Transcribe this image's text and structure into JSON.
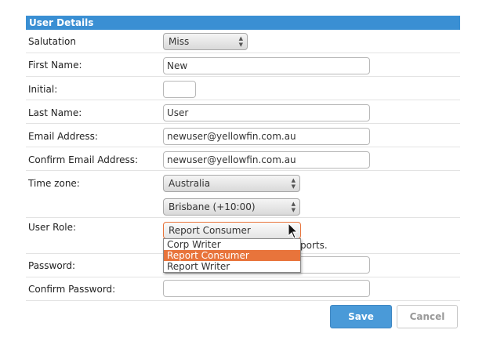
{
  "header": {
    "title": "User Details"
  },
  "form": {
    "salutation": {
      "label": "Salutation",
      "value": "Miss"
    },
    "first_name": {
      "label": "First Name:",
      "value": "New"
    },
    "initial": {
      "label": "Initial:",
      "value": ""
    },
    "last_name": {
      "label": "Last Name:",
      "value": "User"
    },
    "email": {
      "label": "Email Address:",
      "value": "newuser@yellowfin.com.au"
    },
    "confirm_email": {
      "label": "Confirm Email Address:",
      "value": "newuser@yellowfin.com.au"
    },
    "time_zone": {
      "label": "Time zone:",
      "region": "Australia",
      "city": "Brisbane (+10:00)"
    },
    "user_role": {
      "label": "User Role:",
      "value": "Report Consumer",
      "options": [
        "Corp Writer",
        "Report Consumer",
        "Report Writer"
      ],
      "hint_visible": "ports."
    },
    "password": {
      "label": "Password:",
      "value": ""
    },
    "confirm_password": {
      "label": "Confirm Password:",
      "value": ""
    }
  },
  "buttons": {
    "save": "Save",
    "cancel": "Cancel"
  },
  "colors": {
    "header_bg": "#3a8fd3",
    "accent": "#e8743b",
    "save_bg": "#4a9ad8"
  }
}
